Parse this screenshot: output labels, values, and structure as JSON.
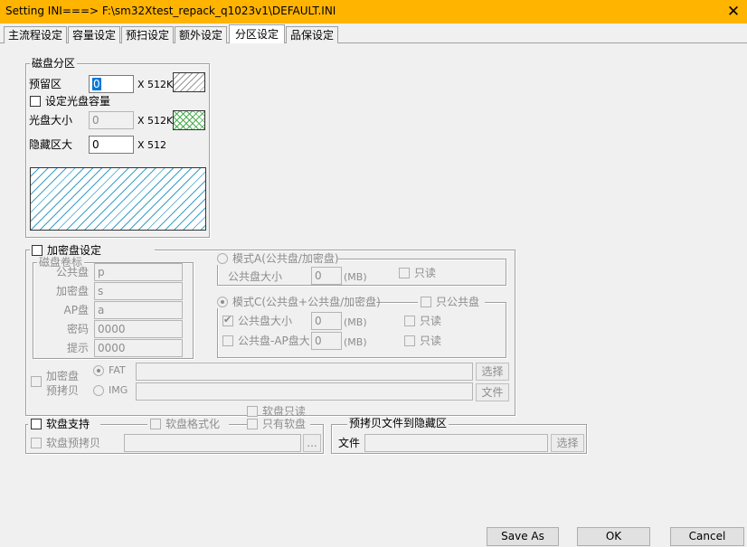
{
  "window": {
    "title": "Setting  INI===> F:\\sm32Xtest_repack_q1023v1\\DEFAULT.INI",
    "close_glyph": "✕"
  },
  "tabs": [
    {
      "label": "主流程设定",
      "active": false
    },
    {
      "label": "容量设定",
      "active": false
    },
    {
      "label": "预扫设定",
      "active": false
    },
    {
      "label": "额外设定",
      "active": false
    },
    {
      "label": "分区设定",
      "active": true
    },
    {
      "label": "品保设定",
      "active": false
    }
  ],
  "partition": {
    "legend": "磁盘分区",
    "reserved_label": "预留区",
    "reserved_value": "0",
    "reserved_unit": "X 512K",
    "set_cd_label": "设定光盘容量",
    "cd_size_label": "光盘大小",
    "cd_size_value": "0",
    "cd_size_unit": "X 512K",
    "hidden_label": "隐藏区大",
    "hidden_value": "0",
    "hidden_unit": "X 512"
  },
  "encrypt": {
    "legend": "加密盘设定",
    "disk_label_legend": "磁盘卷标",
    "public_label": "公共盘",
    "public_value": "p",
    "encrypted_label": "加密盘",
    "encrypted_value": "s",
    "ap_label": "AP盘",
    "ap_value": "a",
    "password_label": "密码",
    "password_value": "0000",
    "hint_label": "提示",
    "hint_value": "0000",
    "mode_a_label": "模式A(公共盘/加密盘)",
    "mode_a_public_size_label": "公共盘大小",
    "mode_a_public_size_value": "0",
    "mb_unit": "(MB)",
    "readonly_label": "只读",
    "mode_c_label": "模式C(公共盘+公共盘/加密盘)",
    "only_public_label": "只公共盘",
    "mode_c_public_size_label": "公共盘大小",
    "mode_c_public_size_value": "0",
    "mode_c_public_ap_label": "公共盘-AP盘大小",
    "mode_c_public_ap_value": "0",
    "precopy_label_1": "加密盘",
    "precopy_label_2": "预拷贝",
    "fat_label": "FAT",
    "img_label": "IMG",
    "select_label": "选择",
    "file_label": "文件",
    "floppy_readonly_label": "软盘只读",
    "only_floppy_label": "只有软盘"
  },
  "floppy": {
    "support_label": "软盘支持",
    "format_label": "软盘格式化",
    "precopy_label": "软盘预拷贝",
    "browse_label": "..."
  },
  "hidden_precopy": {
    "legend": "预拷贝文件到隐藏区",
    "file_label": "文件",
    "select_label": "选择"
  },
  "buttons": {
    "save_as": "Save  As",
    "ok": "OK",
    "cancel": "Cancel"
  }
}
